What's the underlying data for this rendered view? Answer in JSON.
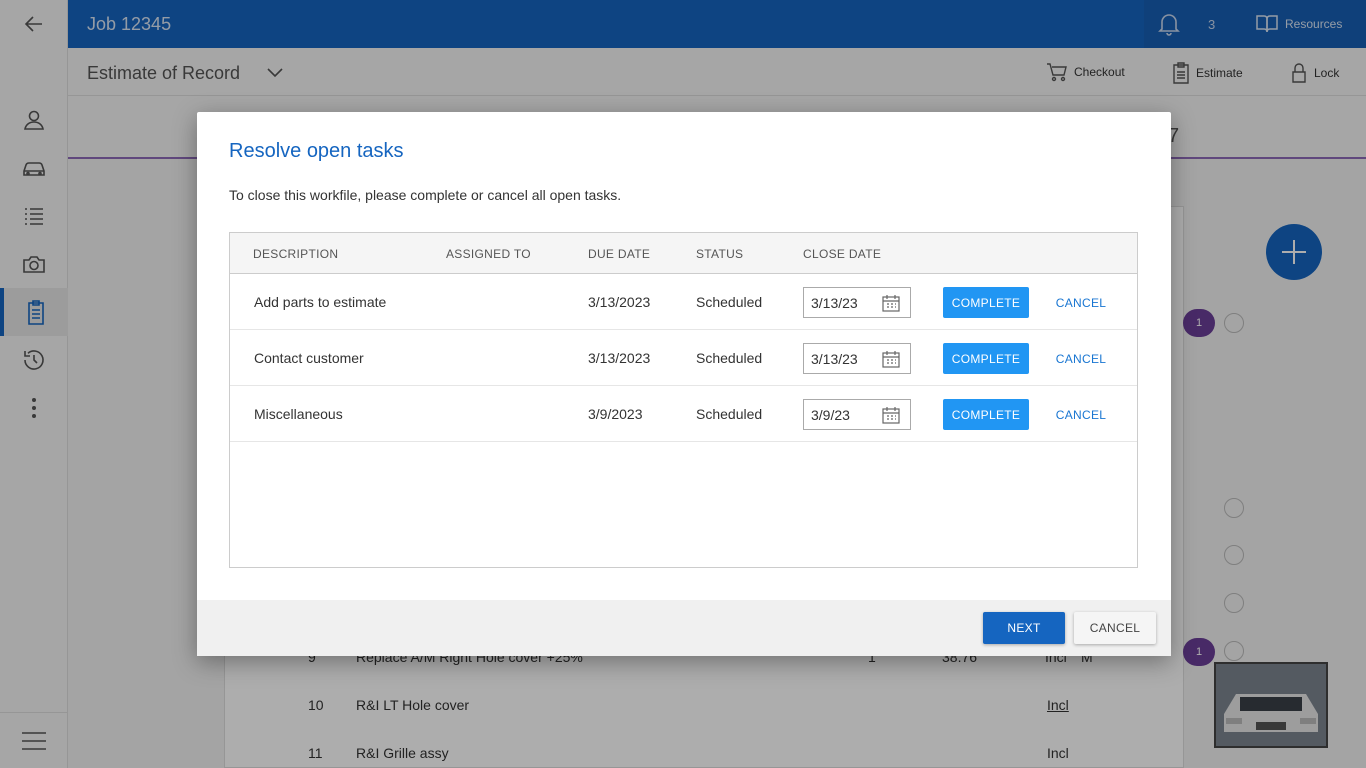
{
  "app": {
    "job_title": "Job 12345",
    "notification_count": "3",
    "resources_label": "Resources",
    "accent": "#1565c0"
  },
  "subbar": {
    "estimate_selector": "Estimate of Record",
    "tools": [
      {
        "label": "Checkout",
        "icon": "cart-icon"
      },
      {
        "label": "Estimate",
        "icon": "clipboard-icon"
      },
      {
        "label": "Lock",
        "icon": "lock-icon"
      }
    ]
  },
  "sidebar": {
    "items": [
      {
        "icon": "person-icon"
      },
      {
        "icon": "car-icon"
      },
      {
        "icon": "list-icon"
      },
      {
        "icon": "camera-icon"
      },
      {
        "icon": "clipboard-icon",
        "active": true
      },
      {
        "icon": "history-icon"
      },
      {
        "icon": "more-vertical-icon"
      }
    ],
    "bottom_icon": "menu-icon"
  },
  "background": {
    "band_fragment": "7",
    "badges": [
      "1",
      "1"
    ],
    "rows": [
      {
        "num": "9",
        "desc": "Replace A/M Right Hole cover +25%",
        "qty": "1",
        "price": "38.76",
        "labor": "Incl",
        "extra": "M"
      },
      {
        "num": "10",
        "desc": "R&I LT Hole cover",
        "labor": "Incl"
      },
      {
        "num": "11",
        "desc": "R&I Grille assy",
        "labor": "Incl"
      }
    ]
  },
  "dialog": {
    "title": "Resolve open tasks",
    "message": "To close this workfile, please complete or cancel all open tasks.",
    "columns": [
      "DESCRIPTION",
      "ASSIGNED TO",
      "DUE DATE",
      "STATUS",
      "CLOSE DATE"
    ],
    "tasks": [
      {
        "description": "Add parts to estimate",
        "assigned_to": "",
        "due_date": "3/13/2023",
        "status": "Scheduled",
        "close_date": "3/13/23"
      },
      {
        "description": "Contact customer",
        "assigned_to": "",
        "due_date": "3/13/2023",
        "status": "Scheduled",
        "close_date": "3/13/23"
      },
      {
        "description": "Miscellaneous",
        "assigned_to": "",
        "due_date": "3/9/2023",
        "status": "Scheduled",
        "close_date": "3/9/23"
      }
    ],
    "complete_label": "COMPLETE",
    "cancel_task_label": "CANCEL",
    "next_label": "NEXT",
    "cancel_label": "CANCEL"
  }
}
